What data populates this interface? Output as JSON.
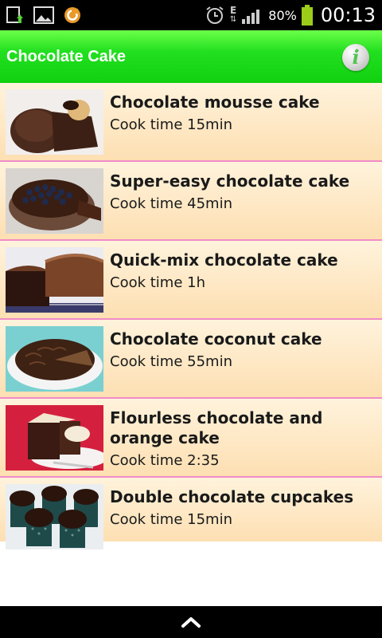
{
  "status_bar": {
    "battery_percent": "80%",
    "time": "00:13",
    "network_type": "E",
    "icons": [
      "download-icon",
      "image-icon",
      "sync-icon",
      "alarm-icon",
      "network-icon",
      "signal-icon",
      "battery-icon"
    ]
  },
  "app_bar": {
    "title": "Chocolate Cake",
    "info_icon": "info-icon",
    "info_glyph": "i"
  },
  "recipes": [
    {
      "title": "Chocolate mousse cake",
      "cook_time": "Cook time 15min"
    },
    {
      "title": "Super-easy chocolate cake",
      "cook_time": "Cook time 45min"
    },
    {
      "title": "Quick-mix chocolate cake",
      "cook_time": "Cook time 1h"
    },
    {
      "title": "Chocolate coconut cake",
      "cook_time": "Cook time 55min"
    },
    {
      "title": "Flourless chocolate and orange cake",
      "cook_time": "Cook time 2:35"
    },
    {
      "title": "Double chocolate cupcakes",
      "cook_time": "Cook time 15min"
    }
  ],
  "colors": {
    "app_bar": "#22e020",
    "list_bg_top": "#fff3dc",
    "list_bg_bottom": "#fddfb2",
    "divider": "#f08cc8",
    "battery": "#9ccc1a"
  },
  "nav_bar": {
    "icon": "chevron-up-icon"
  }
}
